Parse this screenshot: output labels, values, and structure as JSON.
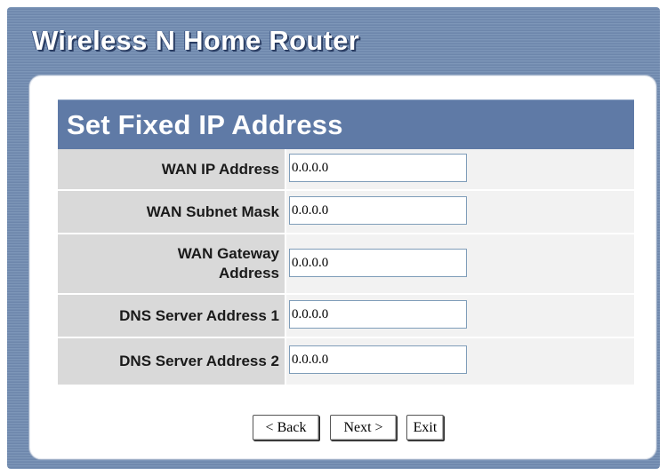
{
  "app": {
    "title": "Wireless N Home Router"
  },
  "section": {
    "title": "Set Fixed IP Address"
  },
  "fields": [
    {
      "label": "WAN IP Address",
      "value": "0.0.0.0"
    },
    {
      "label": "WAN Subnet Mask",
      "value": "0.0.0.0"
    },
    {
      "label_line1": "WAN Gateway",
      "label_line2": "Address",
      "value": "0.0.0.0"
    },
    {
      "label": "DNS Server Address 1",
      "value": "0.0.0.0"
    },
    {
      "label": "DNS Server Address 2",
      "value": "0.0.0.0"
    }
  ],
  "buttons": {
    "back": "< Back",
    "next": "Next >",
    "exit": "Exit"
  },
  "colors": {
    "frame": "#6f88ad",
    "header": "#5f7aa6",
    "label_cell": "#d9d9d9",
    "input_cell": "#f2f2f2"
  }
}
